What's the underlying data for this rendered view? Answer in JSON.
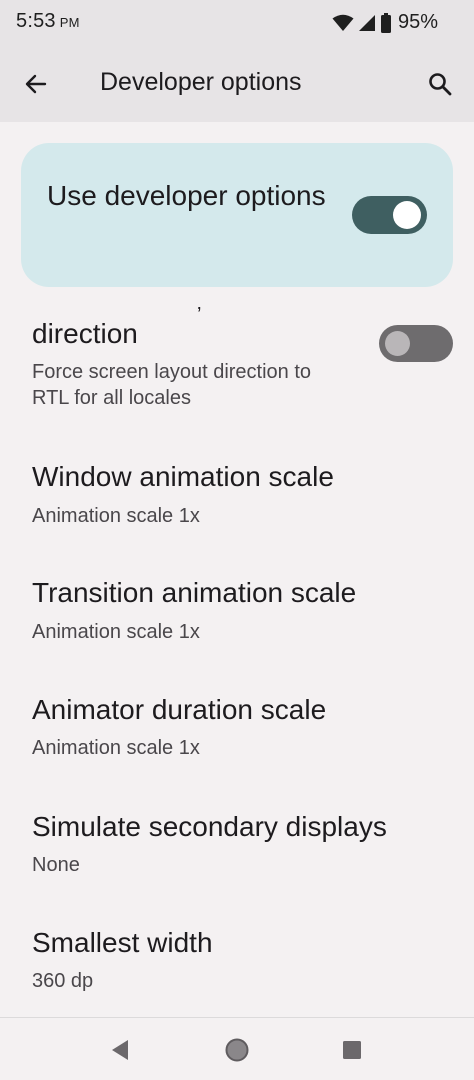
{
  "status_bar": {
    "time": "5:53",
    "ampm": "PM",
    "battery_percent": "95%",
    "icons": [
      "wifi-icon",
      "cellular-signal-icon",
      "battery-icon"
    ]
  },
  "app_bar": {
    "title": "Developer options",
    "back_icon": "back-arrow-icon",
    "search_icon": "search-icon"
  },
  "master_toggle": {
    "label": "Use developer options",
    "checked": true
  },
  "clipped_fragment": "’",
  "settings": [
    {
      "title": "direction",
      "subtitle": "Force screen layout direction to RTL for all locales",
      "toggle": false
    },
    {
      "title": "Window animation scale",
      "subtitle": "Animation scale 1x"
    },
    {
      "title": "Transition animation scale",
      "subtitle": "Animation scale 1x"
    },
    {
      "title": "Animator duration scale",
      "subtitle": "Animation scale 1x"
    },
    {
      "title": "Simulate secondary displays",
      "subtitle": "None"
    },
    {
      "title": "Smallest width",
      "subtitle": "360 dp"
    }
  ],
  "nav_bar": {
    "icons": [
      "nav-back-icon",
      "nav-home-icon",
      "nav-recents-icon"
    ]
  },
  "colors": {
    "accent_card": "#d4e9ec",
    "switch_on_track": "#3f5f61",
    "switch_off_track": "#6e6c6e",
    "background": "#f4f1f2",
    "app_bar": "#e7e4e6"
  }
}
